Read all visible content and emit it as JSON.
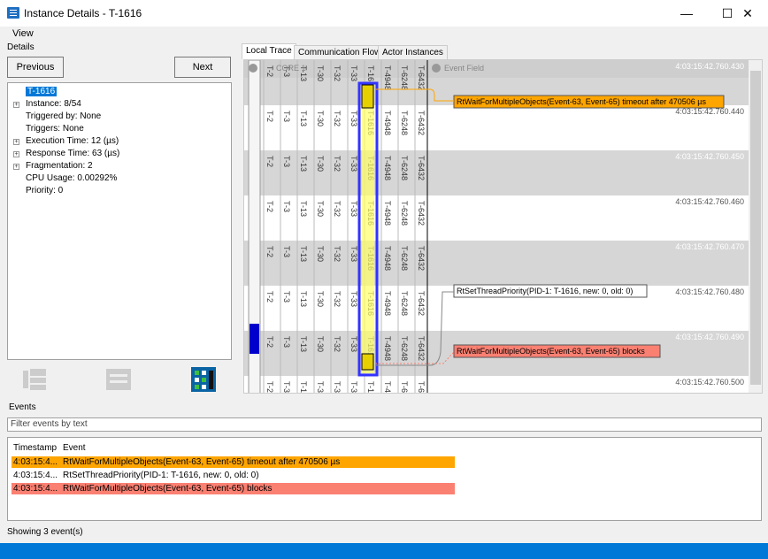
{
  "window": {
    "title": "Instance Details - T-1616",
    "minimize": "—",
    "maximize": "☐",
    "close": "✕"
  },
  "menu": {
    "view": "View"
  },
  "details": {
    "group_label": "Details",
    "previous": "Previous",
    "next": "Next",
    "tree": [
      {
        "label": "T-1616",
        "selected": true
      },
      {
        "label": "Instance: 8/54",
        "expandable": true
      },
      {
        "label": "Triggered by: None"
      },
      {
        "label": "Triggers: None"
      },
      {
        "label": "Execution Time: 12 (µs)",
        "expandable": true
      },
      {
        "label": "Response Time: 63 (µs)",
        "expandable": true
      },
      {
        "label": "Fragmentation: 2",
        "expandable": true
      },
      {
        "label": "CPU Usage: 0.00292%"
      },
      {
        "label": "Priority: 0"
      }
    ]
  },
  "tabs": [
    "Local Trace",
    "Communication Flow",
    "Actor Instances"
  ],
  "trace": {
    "core_label": "CORE 1",
    "event_field_label": "Event Field",
    "thread_columns": [
      "T-2",
      "T-3",
      "T-13",
      "T-30",
      "T-32",
      "T-33",
      "T-1616",
      "T-4948",
      "T-6248",
      "T-6432"
    ],
    "timestamps": [
      "4:03:15:42.760.430",
      "4:03:15:42.760.440",
      "4:03:15:42.760.450",
      "4:03:15:42.760.460",
      "4:03:15:42.760.470",
      "4:03:15:42.760.480",
      "4:03:15:42.760.490",
      "4:03:15:42.760.500"
    ],
    "callouts": [
      {
        "text": "RtWaitForMultipleObjects(Event-63, Event-65) timeout after 470506 µs",
        "color": "#ffa500"
      },
      {
        "text": "RtSetThreadPriority(PID-1: T-1616, new: 0, old: 0)",
        "color": "#ffffff"
      },
      {
        "text": "RtWaitForMultipleObjects(Event-63, Event-65) blocks",
        "color": "#fa8072"
      }
    ]
  },
  "events": {
    "group_label": "Events",
    "filter_placeholder": "Filter events by text",
    "columns": [
      "Timestamp",
      "Event"
    ],
    "rows": [
      {
        "timestamp": "4:03:15:4...",
        "event": "RtWaitForMultipleObjects(Event-63, Event-65) timeout after 470506 µs",
        "color": "#ffa500"
      },
      {
        "timestamp": "4:03:15:4...",
        "event": "RtSetThreadPriority(PID-1: T-1616, new: 0, old: 0)",
        "color": "#ffffff"
      },
      {
        "timestamp": "4:03:15:4...",
        "event": "RtWaitForMultipleObjects(Event-63, Event-65) blocks",
        "color": "#fa8072"
      }
    ]
  },
  "status": {
    "text": "Showing 3 event(s)"
  },
  "colors": {
    "accent": "#0078d7",
    "highlight": "#ffff00",
    "selection_border": "#3333ff"
  }
}
